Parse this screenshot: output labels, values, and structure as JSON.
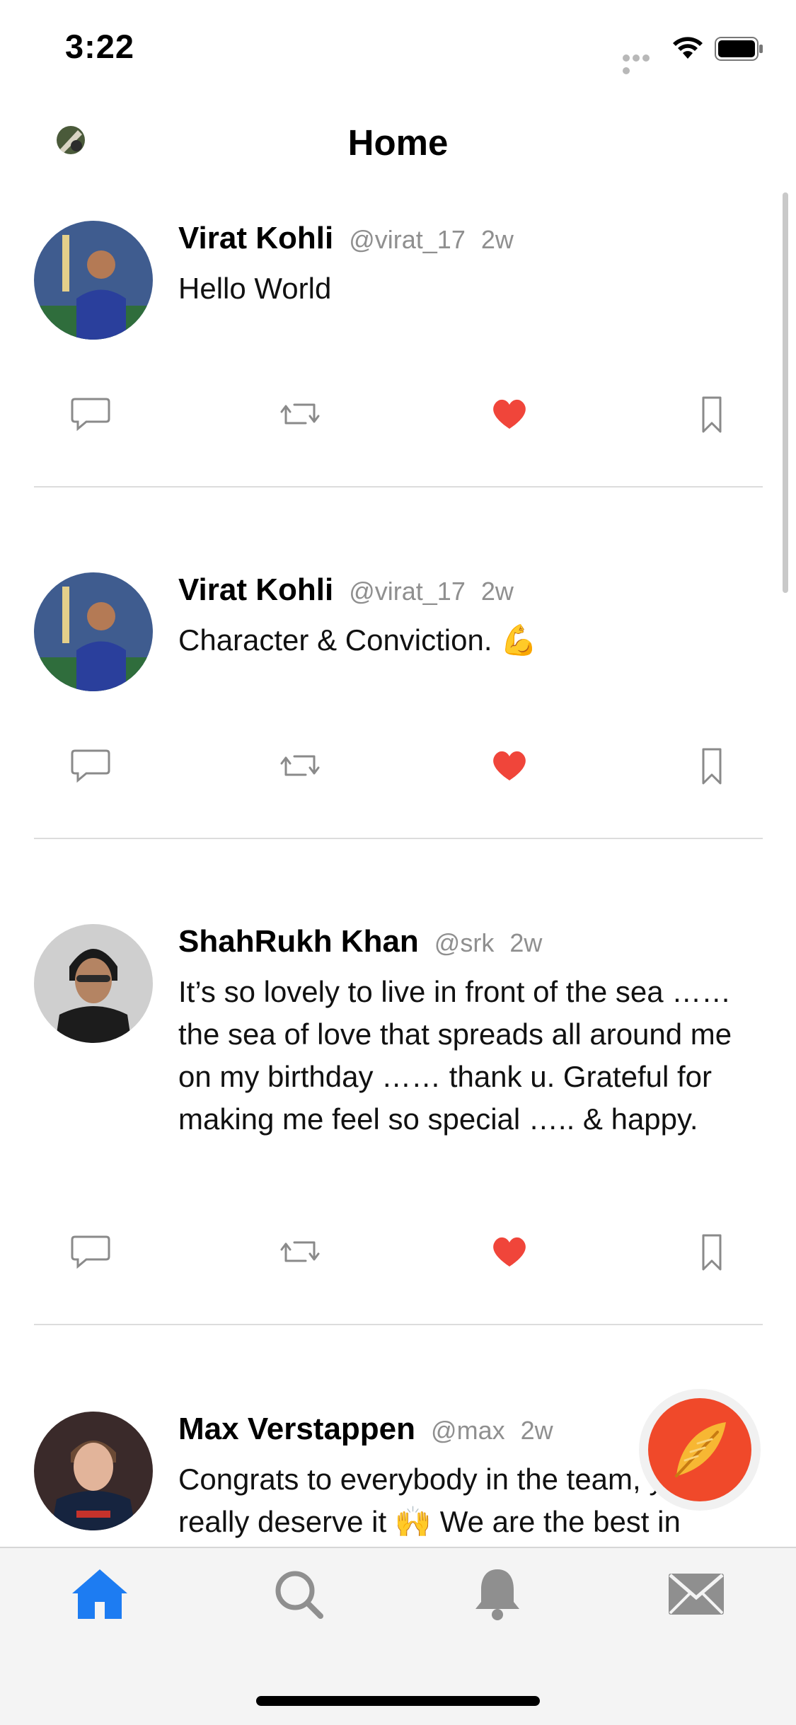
{
  "status_bar": {
    "time": "3:22"
  },
  "nav": {
    "title": "Home"
  },
  "tweets": [
    {
      "name": "Virat Kohli",
      "handle": "@virat_17",
      "time": "2w",
      "text": "Hello World",
      "liked": true
    },
    {
      "name": "Virat Kohli",
      "handle": "@virat_17",
      "time": "2w",
      "text": "Character & Conviction. 💪",
      "liked": true
    },
    {
      "name": "ShahRukh Khan",
      "handle": "@srk",
      "time": "2w",
      "text": "It’s so lovely to live in front of the sea …… the sea of love that spreads all around me on my birthday …… thank u. Grateful for making me feel so special ….. & happy.",
      "liked": true
    },
    {
      "name": "Max Verstappen",
      "handle": "@max",
      "time": "2w",
      "text": "Congrats to everybody in the team, you really deserve it 🙌 We are the best in",
      "liked": false
    }
  ],
  "actions": [
    "comment-icon",
    "retweet-icon",
    "heart-icon",
    "bookmark-icon"
  ],
  "tabs": [
    {
      "name": "home",
      "active": true
    },
    {
      "name": "search",
      "active": false
    },
    {
      "name": "notifications",
      "active": false
    },
    {
      "name": "messages",
      "active": false
    }
  ],
  "colors": {
    "accent": "#1d7cf2",
    "like": "#f0453a",
    "fab": "#f0492a",
    "muted": "#8f8f8f"
  }
}
